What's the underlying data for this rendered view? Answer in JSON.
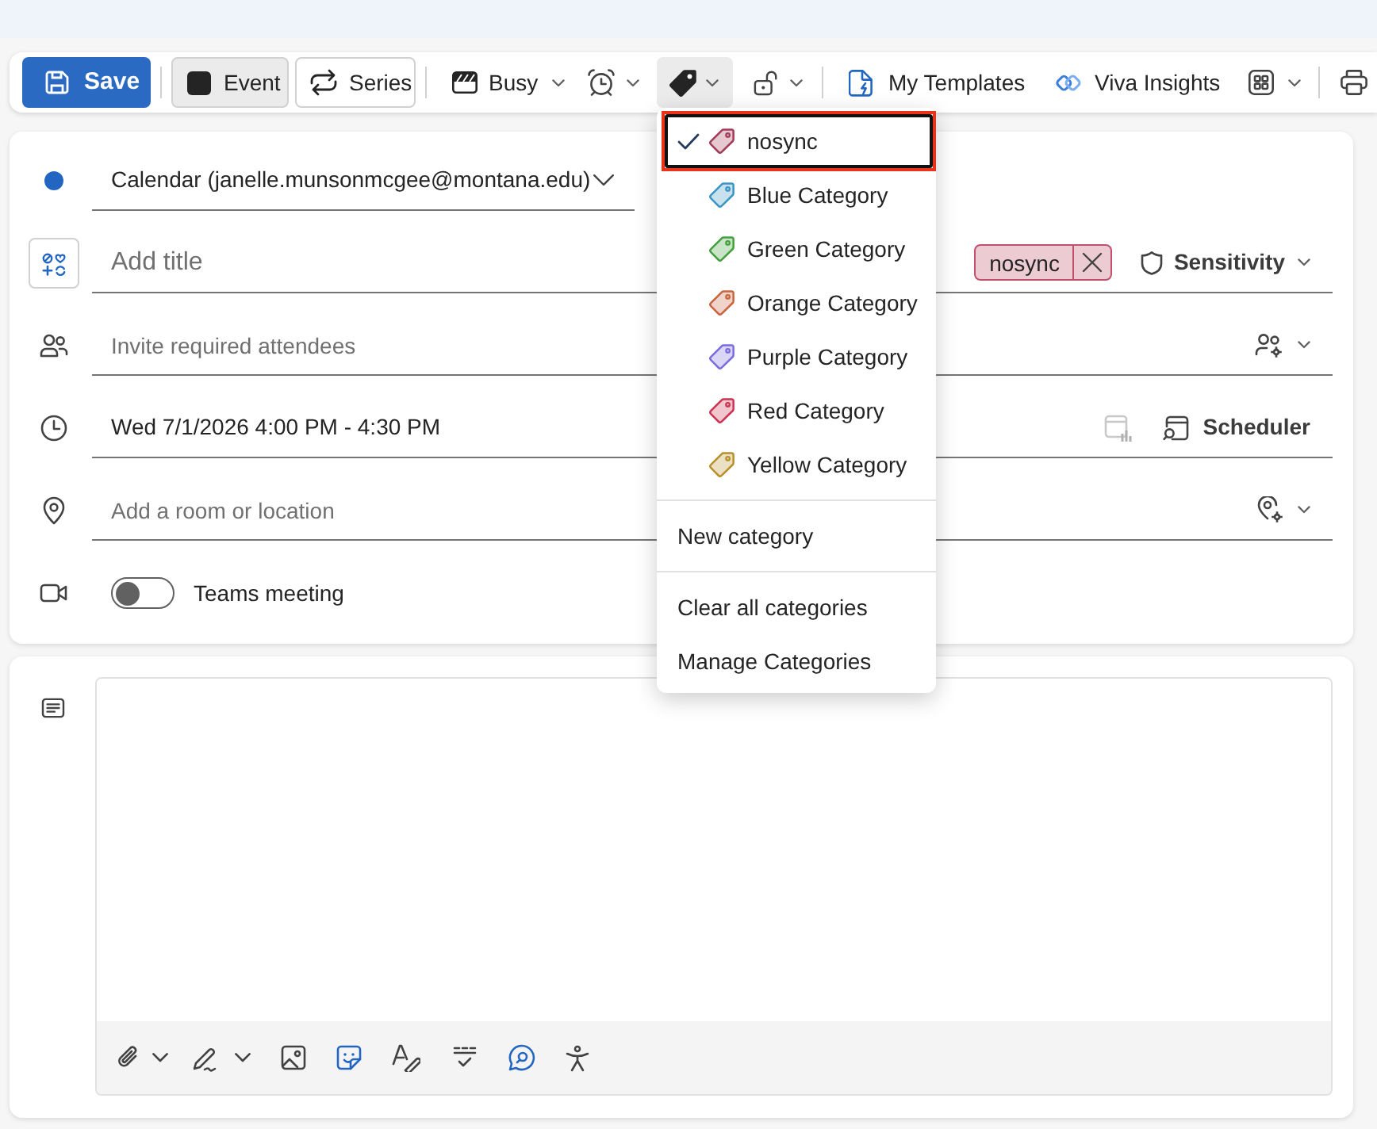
{
  "toolbar": {
    "items": [
      {
        "kind": "primary",
        "label": "Save"
      },
      {
        "kind": "separator"
      },
      {
        "kind": "toggle",
        "label": "Event",
        "selected": true
      },
      {
        "kind": "toggle",
        "label": "Series",
        "selected": false
      },
      {
        "kind": "separator"
      },
      {
        "kind": "menu",
        "label": "Busy",
        "expanded": false
      },
      {
        "kind": "menu",
        "expanded": false
      },
      {
        "kind": "menu",
        "expanded": true
      },
      {
        "kind": "menu",
        "expanded": false
      },
      {
        "kind": "separator"
      },
      {
        "kind": "button",
        "label": "My Templates"
      },
      {
        "kind": "button",
        "label": "Viva Insights"
      },
      {
        "kind": "menu",
        "expanded": false
      },
      {
        "kind": "separator"
      },
      {
        "kind": "button"
      }
    ]
  },
  "form": {
    "calendar": {
      "value": "Calendar (janelle.munsonmcgee@montana.edu)"
    },
    "title": {
      "placeholder": "Add title",
      "tags": [
        {
          "label": "nosync",
          "color": "#c0506d"
        }
      ],
      "sensitivity": "Sensitivity"
    },
    "attendees": {
      "placeholder": "Invite required attendees"
    },
    "time": {
      "value": "Wed 7/1/2026 4:00 PM - 4:30 PM",
      "insights": {
        "disabled": true
      },
      "scheduler": "Scheduler"
    },
    "location": {
      "placeholder": "Add a room or location"
    },
    "teams": {
      "label": "Teams meeting",
      "on": false
    }
  },
  "category_menu": {
    "items": [
      {
        "label": "nosync",
        "color": "#a33a57",
        "selected": true,
        "focused": true
      },
      {
        "label": "Blue Category",
        "color": "#3a94c4",
        "selected": false,
        "focused": false
      },
      {
        "label": "Green Category",
        "color": "#43a03c",
        "selected": false,
        "focused": false
      },
      {
        "label": "Orange Category",
        "color": "#c8643e",
        "selected": false,
        "focused": false
      },
      {
        "label": "Purple Category",
        "color": "#7b6be0",
        "selected": false,
        "focused": false
      },
      {
        "label": "Red Category",
        "color": "#cc3350",
        "selected": false,
        "focused": false
      },
      {
        "label": "Yellow Category",
        "color": "#b88f2a",
        "selected": false,
        "focused": false
      }
    ],
    "action_groups": [
      [
        "New category"
      ],
      [
        "Clear all categories",
        "Manage Categories"
      ]
    ]
  }
}
